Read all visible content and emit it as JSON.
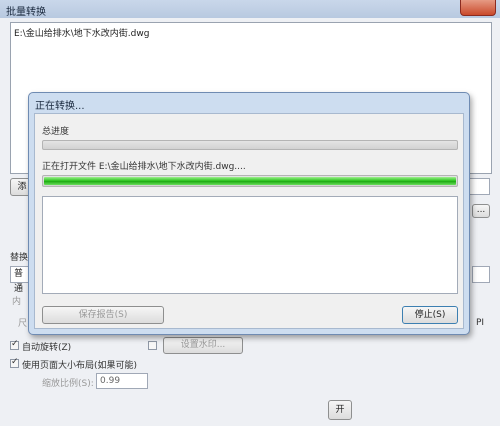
{
  "window": {
    "title": "批量转换"
  },
  "file_list": {
    "items": [
      "E:\\金山给排水\\地下水改内街.dwg"
    ]
  },
  "main": {
    "add_button_partial": "添",
    "browse_button": "...",
    "group_label_partial": "替换",
    "dropdown_partial": "普通",
    "label_partial_1": "内",
    "label_partial_2": "尺",
    "dpi_partial": "PI",
    "auto_rotate_label": "自动旋转(Z)",
    "auto_rotate_checked": true,
    "watermark_checked": false,
    "watermark_button": "设置水印...",
    "use_page_size_label": "使用页面大小布局(如果可能)",
    "use_page_size_checked": true,
    "scale_label": "缩放比例(S):",
    "scale_value": "0.99",
    "bottom_button_partial": "开"
  },
  "progress_dialog": {
    "title": "正在转换...",
    "overall_label": "总进度",
    "overall_progress": 0.0,
    "file_label": "正在打开文件 E:\\金山给排水\\地下水改内街.dwg....",
    "file_progress": 1.0,
    "save_report_button": "保存报告(S)",
    "stop_button": "停止(S)"
  },
  "colors": {
    "progress_green": "#27c21a",
    "title_bar": "#c9d7ea"
  }
}
